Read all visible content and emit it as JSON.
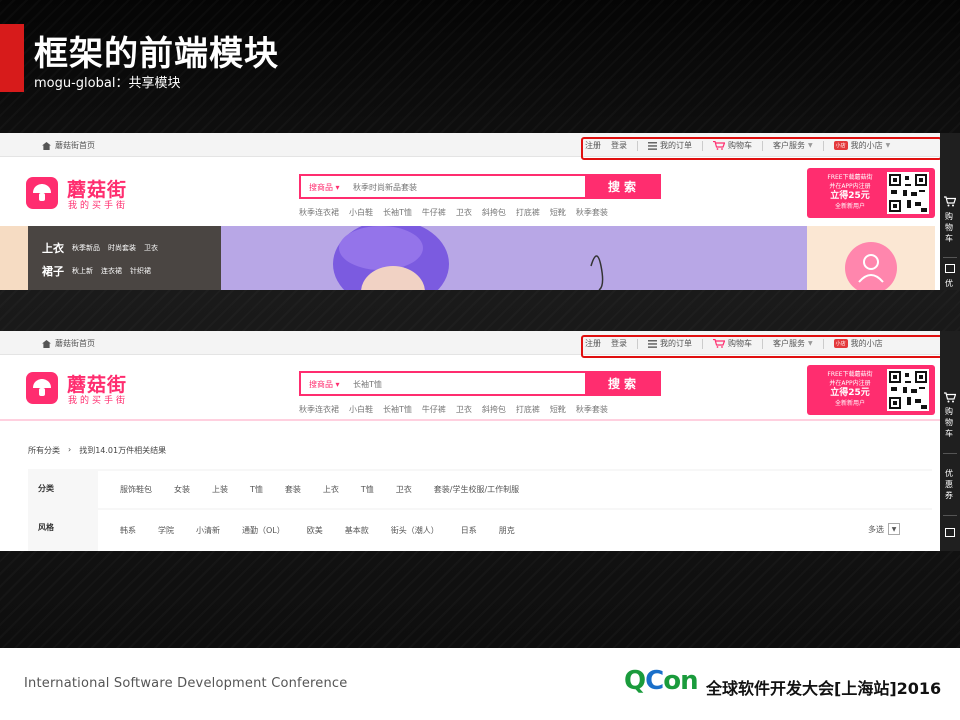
{
  "slide": {
    "title": "框架的前端模块",
    "subtitle": "mogu-global：共享模块",
    "accent_color": "#d71b1b"
  },
  "site": {
    "brand_color": "#ff2d6f",
    "home_link": "蘑菇街首页",
    "topbar": {
      "register": "注册",
      "login": "登录",
      "orders": "我的订单",
      "cart": "购物车",
      "service": "客户服务",
      "shop_badge": "小店",
      "shop": "我的小店"
    },
    "logo": {
      "name": "蘑菇街",
      "slogan": "我的买手街"
    },
    "search_button": "搜索",
    "search_category": "搜商品",
    "hot_words": [
      "秋季连衣裙",
      "小白鞋",
      "长袖T恤",
      "牛仔裤",
      "卫衣",
      "斜挎包",
      "打底裤",
      "短靴",
      "秋季套装"
    ],
    "promo": {
      "line1": "FREE下载蘑菇街",
      "line2": "并在APP内注册",
      "line3": "立得25元",
      "line4": "全新新用户"
    },
    "sidebar": {
      "cart": "购物车",
      "coupon": "优惠券",
      "coupon_short": "优"
    }
  },
  "shot1": {
    "search_placeholder": "秋季时尚新品套装",
    "categories": [
      {
        "main": "上衣",
        "subs": [
          "秋季新品",
          "时尚套装",
          "卫衣"
        ]
      },
      {
        "main": "裙子",
        "subs": [
          "秋上新",
          "连衣裙",
          "针织裙"
        ]
      }
    ]
  },
  "shot2": {
    "search_placeholder": "长袖T恤",
    "breadcrumb": {
      "all": "所有分类",
      "sep": "›",
      "result": "找到14.01万件相关结果"
    },
    "filters": [
      {
        "label": "分类",
        "values": [
          "服饰鞋包",
          "女装",
          "上装",
          "T恤",
          "套装",
          "上衣",
          "T恤",
          "卫衣",
          "套装/学生校服/工作制服"
        ]
      },
      {
        "label": "风格",
        "values": [
          "韩系",
          "学院",
          "小清新",
          "通勤（OL）",
          "欧美",
          "基本款",
          "街头（潮人）",
          "日系",
          "朋克"
        ]
      }
    ],
    "more": "多选"
  },
  "footer": {
    "conference_en": "International Software Development Conference",
    "qcon_q": "Q",
    "qcon_c": "C",
    "qcon_on": "on",
    "conference_cn": "全球软件开发大会[上海站]2016"
  }
}
